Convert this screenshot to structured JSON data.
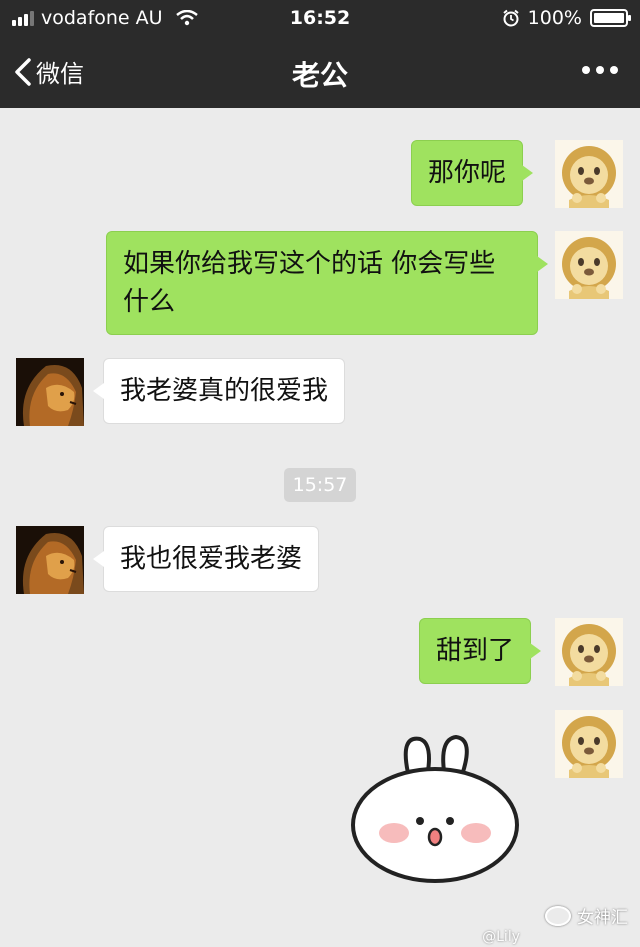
{
  "status_bar": {
    "carrier": "vodafone AU",
    "time": "16:52",
    "battery": "100%",
    "battery_level": 1.0,
    "signal_bars": 3,
    "icons": [
      "signal-icon",
      "wifi-icon",
      "alarm-icon",
      "battery-icon"
    ]
  },
  "nav": {
    "back_label": "微信",
    "title": "老公",
    "icons": [
      "chevron-left-icon",
      "more-icon"
    ]
  },
  "messages": [
    {
      "sender": "me",
      "text": "那你呢"
    },
    {
      "sender": "me",
      "text": "如果你给我写这个的话 你会写些什么"
    },
    {
      "sender": "other",
      "text": "我老婆真的很爱我"
    },
    {
      "sender": "other",
      "text": "我也很爱我老婆"
    },
    {
      "sender": "me",
      "text": "甜到了"
    },
    {
      "sender": "me",
      "type": "sticker",
      "icon": "bunny-sticker-icon"
    }
  ],
  "timestamp": "15:57",
  "avatars": {
    "me": "lion-cartoon-avatar",
    "other": "lion-photo-avatar"
  },
  "watermark": {
    "text": "女神汇",
    "sub": "@Lily"
  },
  "colors": {
    "nav_bg": "#2b2b2b",
    "chat_bg": "#ebebeb",
    "my_bubble": "#9fe25f",
    "other_bubble": "#ffffff"
  }
}
